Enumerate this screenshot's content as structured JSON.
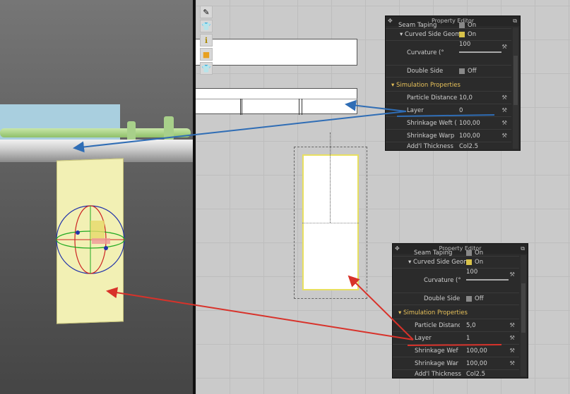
{
  "toolbar": {
    "tools": [
      "pen-icon",
      "shirt-pin-icon",
      "info-icon",
      "folder-icon",
      "shirt-lock-icon"
    ]
  },
  "editors": [
    {
      "title": "Property Editor",
      "seam_taping": "Seam Taping",
      "seam_taping_value": "On",
      "curved": "Curved Side Geom",
      "curved_value": "On",
      "curvature": "Curvature (°",
      "curvature_value": "100",
      "double": "Double Side",
      "double_value": "Off",
      "section": "Simulation Properties",
      "particle": "Particle Distance (",
      "particle_value": "10,0",
      "layer": "Layer",
      "layer_value": "0",
      "weft": "Shrinkage Weft (",
      "weft_value": "100,00",
      "warp": "Shrinkage Warp (",
      "warp_value": "100,00",
      "thick": "Add'l Thickness",
      "thick_value": "Col2.5"
    },
    {
      "title": "Property Editor",
      "seam_taping": "Seam Taping",
      "seam_taping_value": "On",
      "curved": "Curved Side Geom",
      "curved_value": "On",
      "curvature": "Curvature (°",
      "curvature_value": "100",
      "double": "Double Side",
      "double_value": "Off",
      "section": "Simulation Properties",
      "particle": "Particle Distance (",
      "particle_value": "5,0",
      "layer": "Layer",
      "layer_value": "1",
      "weft": "Shrinkage Weft (",
      "weft_value": "100,00",
      "warp": "Shrinkage Warp (",
      "warp_value": "100,00",
      "thick": "Add'l Thickness",
      "thick_value": "Col2.5"
    }
  ],
  "colors": {
    "blue_annotation": "#2f6db5",
    "red_annotation": "#d8322a",
    "section": "#e8c25a"
  }
}
